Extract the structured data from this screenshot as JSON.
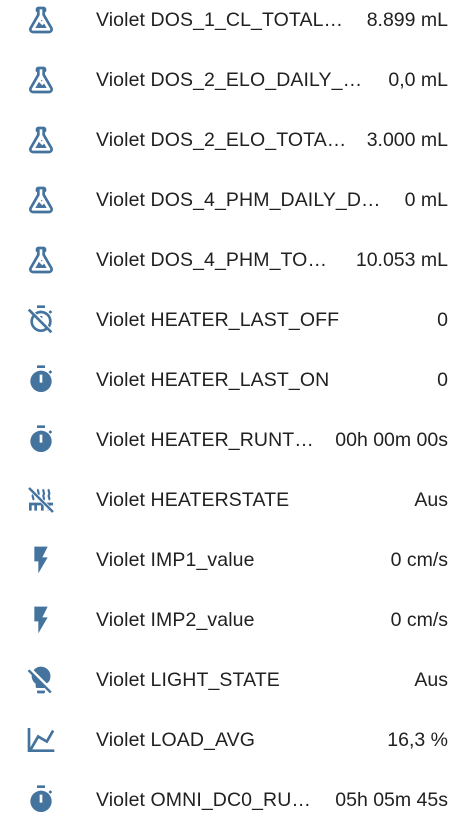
{
  "accent_color": "#44739e",
  "rows": [
    {
      "icon": "flask-icon",
      "label": "Violet DOS_1_CL_TOTAL…",
      "value": "8.899 mL"
    },
    {
      "icon": "flask-icon",
      "label": "Violet DOS_2_ELO_DAILY_D…",
      "value": "0,0 mL"
    },
    {
      "icon": "flask-icon",
      "label": "Violet DOS_2_ELO_TOTA…",
      "value": "3.000 mL"
    },
    {
      "icon": "flask-icon",
      "label": "Violet DOS_4_PHM_DAILY_D…",
      "value": "0 mL"
    },
    {
      "icon": "flask-icon",
      "label": "Violet DOS_4_PHM_TO…",
      "value": "10.053 mL"
    },
    {
      "icon": "timer-off-icon",
      "label": "Violet HEATER_LAST_OFF",
      "value": "0"
    },
    {
      "icon": "timer-icon",
      "label": "Violet HEATER_LAST_ON",
      "value": "0"
    },
    {
      "icon": "timer-icon",
      "label": "Violet HEATER_RUNT…",
      "value": "00h 00m 00s"
    },
    {
      "icon": "heating-off-icon",
      "label": "Violet HEATERSTATE",
      "value": "Aus"
    },
    {
      "icon": "flash-icon",
      "label": "Violet IMP1_value",
      "value": "0 cm/s"
    },
    {
      "icon": "flash-icon",
      "label": "Violet IMP2_value",
      "value": "0 cm/s"
    },
    {
      "icon": "lightbulb-off-icon",
      "label": "Violet LIGHT_STATE",
      "value": "Aus"
    },
    {
      "icon": "chart-line-icon",
      "label": "Violet LOAD_AVG",
      "value": "16,3 %"
    },
    {
      "icon": "timer-icon",
      "label": "Violet OMNI_DC0_RU…",
      "value": "05h 05m 45s"
    }
  ]
}
